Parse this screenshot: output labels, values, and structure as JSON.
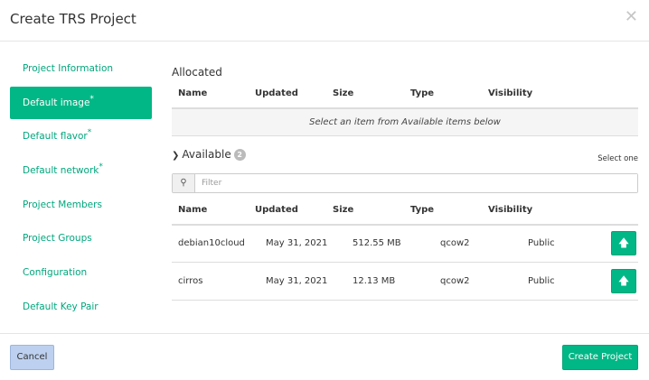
{
  "dialog": {
    "title": "Create TRS Project",
    "close_glyph": "✕"
  },
  "nav": {
    "items": [
      {
        "label": "Project Information",
        "required": ""
      },
      {
        "label": "Default image",
        "required": "*"
      },
      {
        "label": "Default flavor",
        "required": "*"
      },
      {
        "label": "Default network",
        "required": "*"
      },
      {
        "label": "Project Members",
        "required": ""
      },
      {
        "label": "Project Groups",
        "required": ""
      },
      {
        "label": "Configuration",
        "required": ""
      },
      {
        "label": "Default Key Pair",
        "required": ""
      }
    ],
    "active_index": 1
  },
  "allocated": {
    "title": "Allocated",
    "columns": [
      "Name",
      "Updated",
      "Size",
      "Type",
      "Visibility"
    ],
    "empty_message": "Select an item from Available items below"
  },
  "available": {
    "title": "Available",
    "count": "2",
    "select_hint": "Select one",
    "filter_placeholder": "Filter",
    "filter_value": "",
    "columns": [
      "Name",
      "Updated",
      "Size",
      "Type",
      "Visibility"
    ],
    "rows": [
      {
        "name": "debian10cloud",
        "updated": "May 31, 2021",
        "size": "512.55 MB",
        "type": "qcow2",
        "visibility": "Public"
      },
      {
        "name": "cirros",
        "updated": "May 31, 2021",
        "size": "12.13 MB",
        "type": "qcow2",
        "visibility": "Public"
      }
    ]
  },
  "footer": {
    "cancel_label": "Cancel",
    "create_label": "Create Project"
  },
  "colors": {
    "accent": "#00b785",
    "link": "#00a77c",
    "cancel_bg": "#bdd0ef"
  }
}
